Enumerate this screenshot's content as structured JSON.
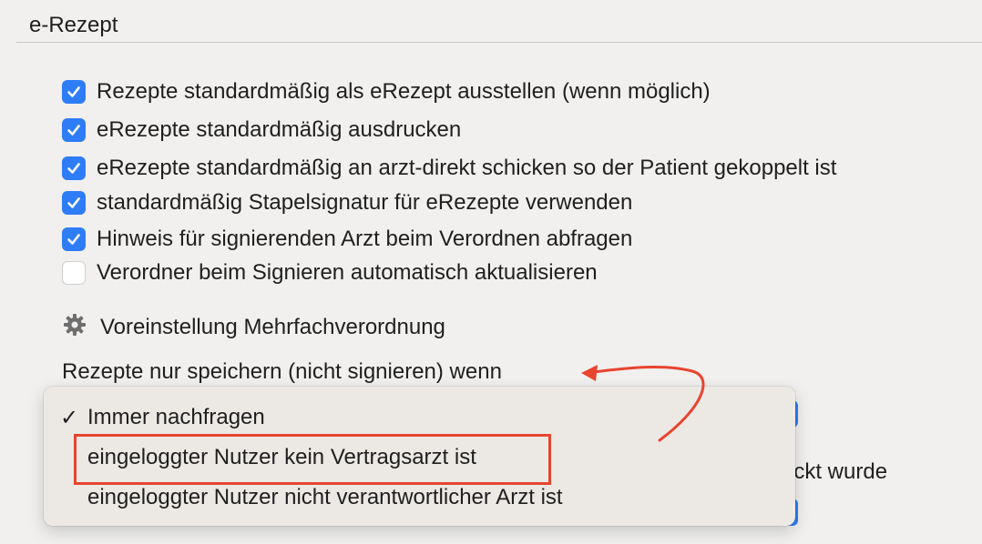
{
  "section": {
    "title": "e-Rezept"
  },
  "checkboxes": [
    {
      "label": "Rezepte standardmäßig als eRezept ausstellen (wenn möglich)",
      "checked": true
    },
    {
      "label": "eRezepte standardmäßig ausdrucken",
      "checked": true
    },
    {
      "label": "eRezepte standardmäßig an arzt-direkt schicken so der Patient gekoppelt ist",
      "checked": true
    },
    {
      "label": "standardmäßig Stapelsignatur für eRezepte verwenden",
      "checked": true
    },
    {
      "label": "Hinweis für signierenden Arzt beim Verordnen abfragen",
      "checked": true
    },
    {
      "label": "Verordner beim Signieren automatisch aktualisieren",
      "checked": false
    }
  ],
  "multi_prescription": {
    "label": "Voreinstellung Mehrfachverordnung",
    "icon": "gear-icon"
  },
  "save_condition": {
    "label": "Rezepte nur speichern (nicht signieren) wenn"
  },
  "obscured_text": "eckt wurde",
  "dropdown_menu": {
    "check_glyph": "✓",
    "items": [
      {
        "label": "Immer nachfragen",
        "selected": true
      },
      {
        "label": "eingeloggter Nutzer kein Vertragsarzt ist",
        "selected": false,
        "highlighted_annotation": true
      },
      {
        "label": "eingeloggter Nutzer nicht verantwortlicher Arzt ist",
        "selected": false
      }
    ]
  },
  "colors": {
    "checkbox_blue": "#2f7df6",
    "annotation_red": "#e8442f",
    "background": "#f1f0ef"
  }
}
